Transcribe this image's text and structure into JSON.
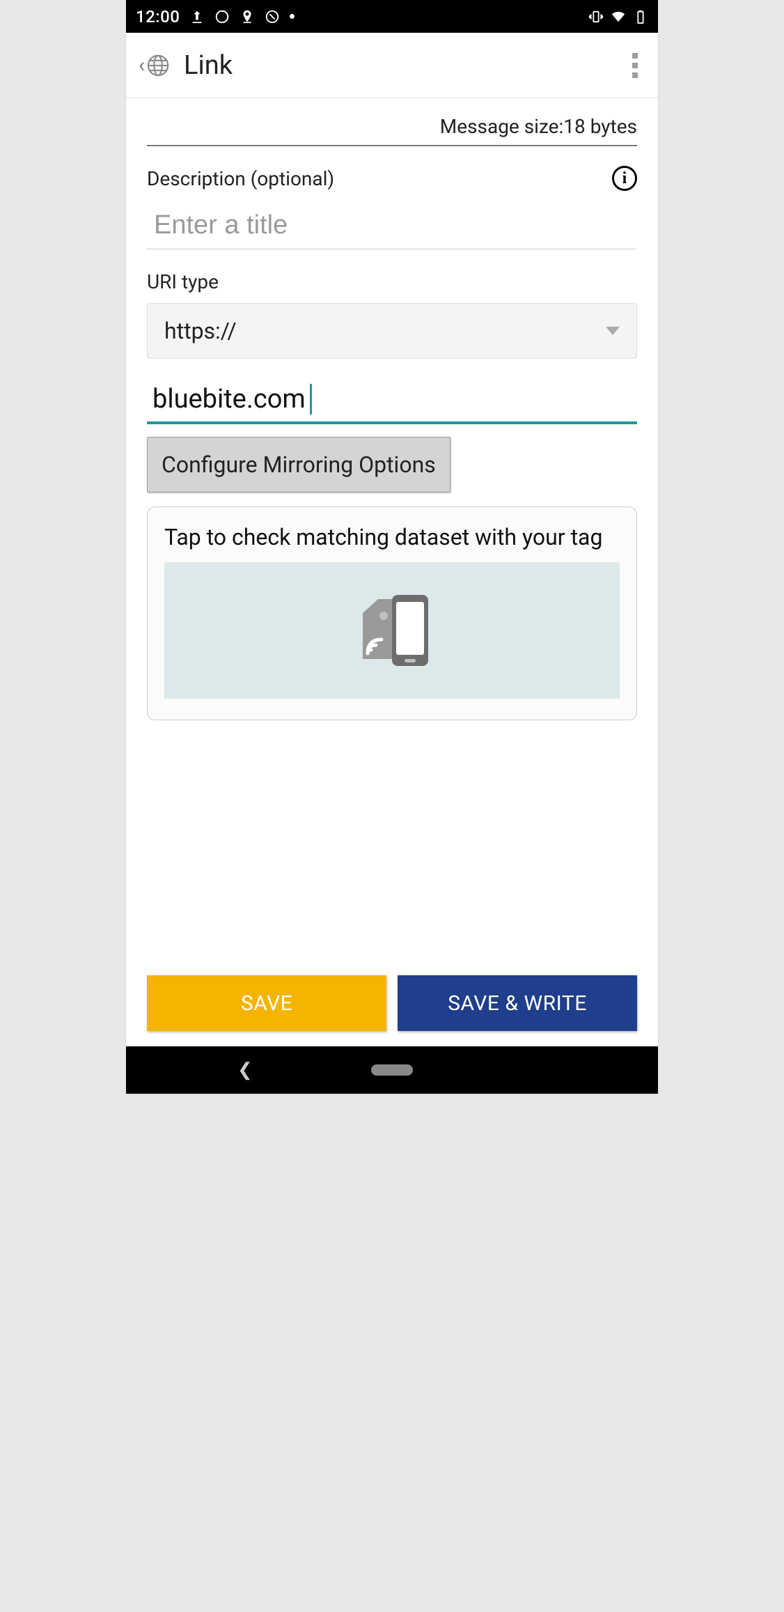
{
  "status": {
    "time": "12:00"
  },
  "app": {
    "title": "Link"
  },
  "message_size": {
    "prefix": "Message size:",
    "value": "18 bytes"
  },
  "description": {
    "label": "Description (optional)",
    "placeholder": "Enter a title",
    "value": ""
  },
  "uri_type": {
    "label": "URI type",
    "selected": "https://"
  },
  "url_field": {
    "value": "bluebite.com"
  },
  "config_button": "Configure Mirroring Options",
  "tap_card": {
    "text": "Tap to check matching dataset with your tag"
  },
  "buttons": {
    "save": "SAVE",
    "save_write": "SAVE & WRITE"
  }
}
